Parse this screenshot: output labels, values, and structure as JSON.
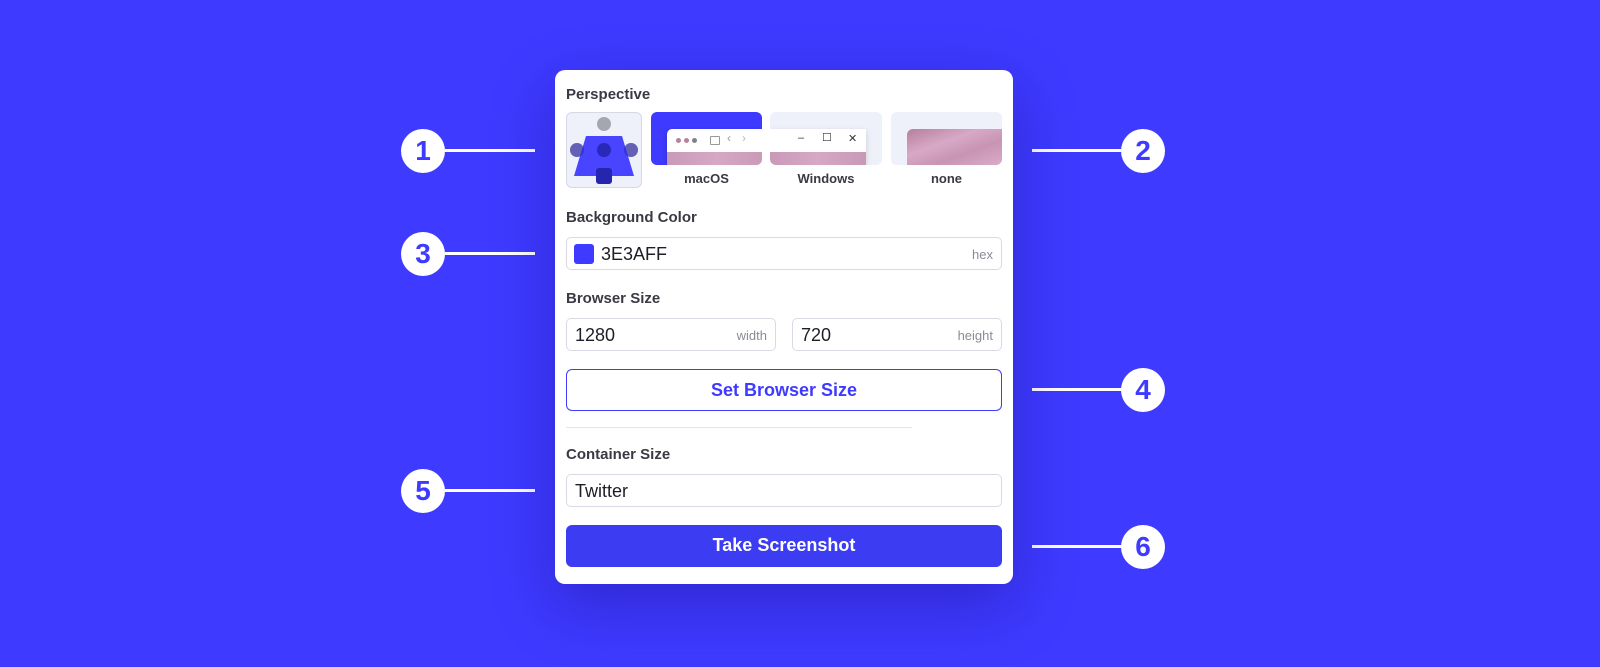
{
  "panel": {
    "perspective": {
      "label": "Perspective",
      "options": [
        {
          "name": "perspective-3d",
          "label": ""
        },
        {
          "name": "macOS",
          "label": "macOS"
        },
        {
          "name": "Windows",
          "label": "Windows"
        },
        {
          "name": "none",
          "label": "none"
        }
      ],
      "windows_controls": [
        "–",
        "☐",
        "✕"
      ],
      "mac_nav": [
        "‹",
        "›"
      ]
    },
    "background_color": {
      "label": "Background Color",
      "value": "3E3AFF",
      "hint": "hex",
      "swatch": "#3e3aff"
    },
    "browser_size": {
      "label": "Browser Size",
      "width_value": "1280",
      "width_hint": "width",
      "height_value": "720",
      "height_hint": "height",
      "set_button": "Set Browser Size"
    },
    "container_size": {
      "label": "Container Size",
      "value": "Twitter"
    },
    "take_screenshot": "Take Screenshot"
  },
  "callouts": [
    "1",
    "2",
    "3",
    "4",
    "5",
    "6"
  ],
  "colors": {
    "accent": "#3e3aff",
    "button": "#3c3cf2"
  }
}
